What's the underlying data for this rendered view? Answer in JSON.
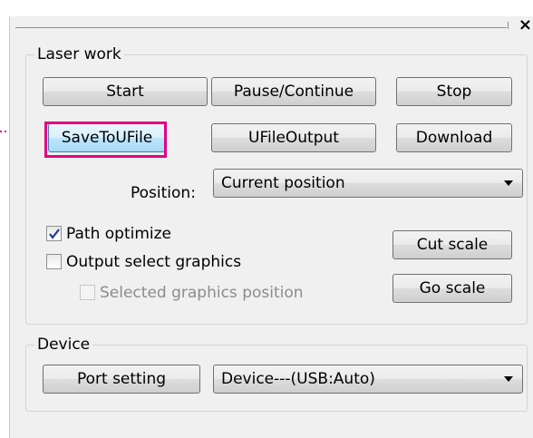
{
  "titlebar": {
    "close_label": "×"
  },
  "laser_work": {
    "title": "Laser work",
    "start_label": "Start",
    "pause_label": "Pause/Continue",
    "stop_label": "Stop",
    "save_label": "SaveToUFile",
    "ufile_output_label": "UFileOutput",
    "download_label": "Download",
    "position_label": "Position:",
    "position_value": "Current position",
    "path_optimize_label": "Path optimize",
    "path_optimize_checked": true,
    "output_select_label": "Output select graphics",
    "output_select_checked": false,
    "selected_position_label": "Selected graphics position",
    "selected_position_checked": false,
    "cut_scale_label": "Cut scale",
    "go_scale_label": "Go scale"
  },
  "device": {
    "title": "Device",
    "port_setting_label": "Port setting",
    "device_value": "Device---(USB:Auto)"
  },
  "colors": {
    "highlight": "#e3007f",
    "pointer": "#e3007f"
  },
  "icons": {
    "pointer": "dotted-arrow-icon",
    "check": "checkmark-icon",
    "dropdown": "chevron-down-icon"
  }
}
